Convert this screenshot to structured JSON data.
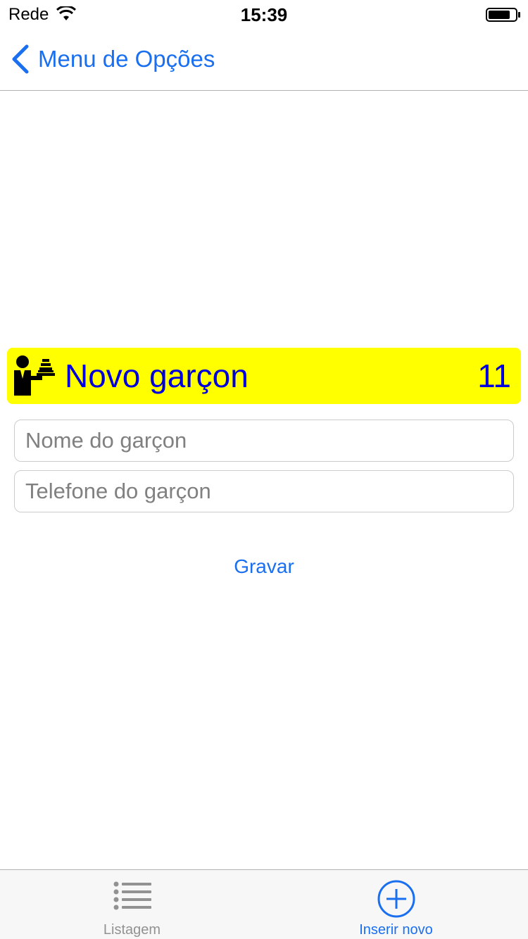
{
  "status_bar": {
    "carrier": "Rede",
    "time": "15:39",
    "wifi_icon": "wifi-icon",
    "battery_icon": "battery-icon"
  },
  "nav": {
    "back_label": "Menu de Opções",
    "back_icon": "chevron-left-icon"
  },
  "header": {
    "title": "Novo garçon",
    "count": "11",
    "icon": "waiter-icon",
    "background": "#ffff00",
    "text_color": "#0000dd"
  },
  "form": {
    "name_placeholder": "Nome do garçon",
    "name_value": "",
    "phone_placeholder": "Telefone do garçon",
    "phone_value": "",
    "save_label": "Gravar"
  },
  "tab_bar": {
    "tabs": [
      {
        "label": "Listagem",
        "icon": "list-icon",
        "selected": false
      },
      {
        "label": "Inserir novo",
        "icon": "plus-circle-icon",
        "selected": true
      }
    ]
  },
  "colors": {
    "accent": "#1a6ff0",
    "inactive": "#929292"
  }
}
